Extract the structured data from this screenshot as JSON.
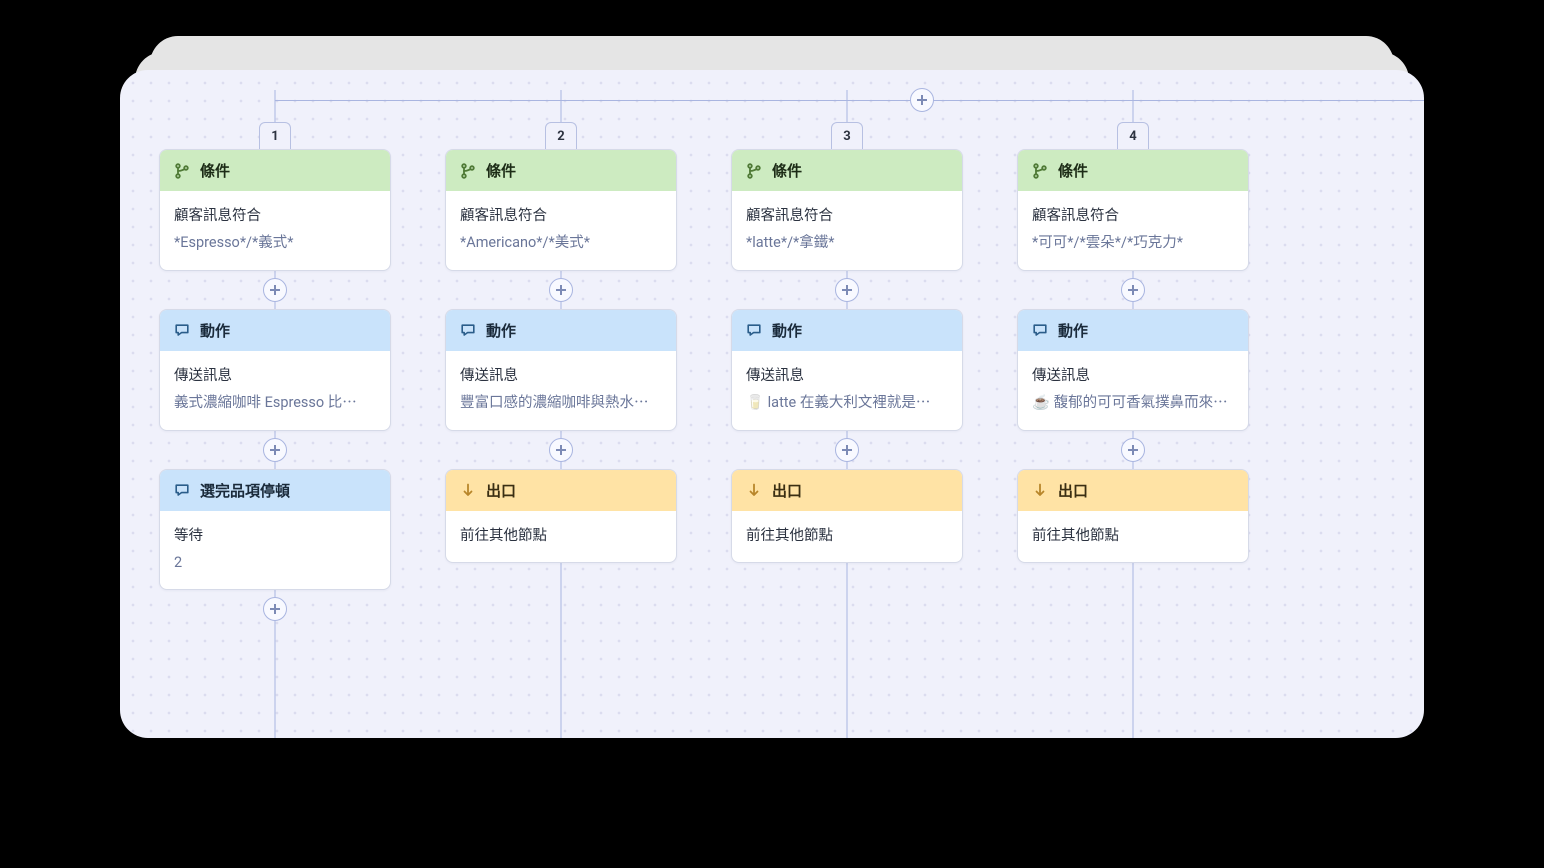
{
  "labels": {
    "condition": "條件",
    "action": "動作",
    "exit": "出口",
    "pause": "選完品項停頓"
  },
  "body": {
    "customer_match": "顧客訊息符合",
    "send_message": "傳送訊息",
    "wait": "等待",
    "goto_other": "前往其他節點"
  },
  "columns": [
    {
      "num": "1",
      "condition_sub": "*Espresso*/*義式*",
      "action_sub": "義式濃縮咖啡 Espresso 比⋯",
      "third": {
        "type": "pause",
        "value": "2"
      }
    },
    {
      "num": "2",
      "condition_sub": "*Americano*/*美式*",
      "action_sub": "豐富口感的濃縮咖啡與熱水⋯",
      "third": {
        "type": "exit"
      }
    },
    {
      "num": "3",
      "condition_sub": "*latte*/*拿鐵*",
      "action_sub": "🥛 latte 在義大利文裡就是⋯",
      "third": {
        "type": "exit"
      }
    },
    {
      "num": "4",
      "condition_sub": "*可可*/*雲朵*/*巧克力*",
      "action_sub": "☕ 馥郁的可可香氣撲鼻而來⋯",
      "third": {
        "type": "exit"
      }
    }
  ]
}
